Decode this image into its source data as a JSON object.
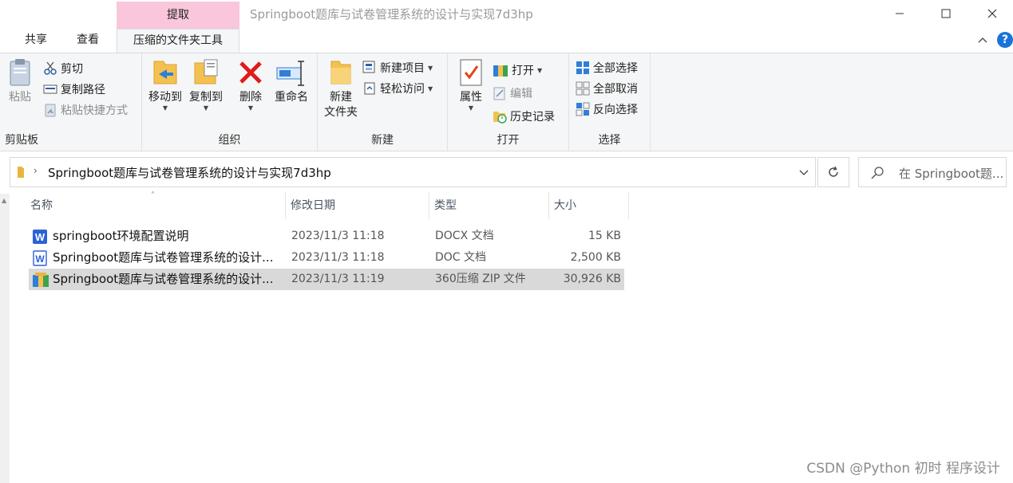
{
  "window": {
    "title": "Springboot题库与试卷管理系统的设计与实现7d3hp",
    "context_tab": "提取"
  },
  "tabs": {
    "share": "共享",
    "view": "查看",
    "tools": "压缩的文件夹工具"
  },
  "ribbon": {
    "clipboard": {
      "paste": "粘贴",
      "cut": "剪切",
      "copy_path": "复制路径",
      "paste_shortcut": "粘贴快捷方式",
      "label": "剪贴板"
    },
    "organize": {
      "move_to": "移动到",
      "copy_to": "复制到",
      "delete": "删除",
      "rename": "重命名",
      "label": "组织"
    },
    "new": {
      "new_folder_line1": "新建",
      "new_folder_line2": "文件夹",
      "new_item": "新建项目",
      "easy_access": "轻松访问",
      "label": "新建"
    },
    "open": {
      "properties": "属性",
      "open": "打开",
      "edit": "编辑",
      "history": "历史记录",
      "label": "打开"
    },
    "select": {
      "select_all": "全部选择",
      "select_none": "全部取消",
      "invert": "反向选择",
      "label": "选择"
    }
  },
  "address": {
    "path": "Springboot题库与试卷管理系统的设计与实现7d3hp",
    "search_placeholder": "在 Springboot题..."
  },
  "columns": {
    "name": "名称",
    "date": "修改日期",
    "type": "类型",
    "size": "大小"
  },
  "files": [
    {
      "name": "springboot环境配置说明",
      "date": "2023/11/3 11:18",
      "type": "DOCX 文档",
      "size": "15 KB",
      "icon": "wps-word-icon"
    },
    {
      "name": "Springboot题库与试卷管理系统的设计...",
      "date": "2023/11/3 11:18",
      "type": "DOC 文档",
      "size": "2,500 KB",
      "icon": "word-doc-icon"
    },
    {
      "name": "Springboot题库与试卷管理系统的设计...",
      "date": "2023/11/3 11:19",
      "type": "360压缩 ZIP 文件",
      "size": "30,926 KB",
      "icon": "zip-archive-icon",
      "selected": true
    }
  ],
  "watermark": "CSDN @Python 初时 程序设计",
  "colors": {
    "context_tab": "#f9c6db",
    "ribbon_bg": "#f5f6f7",
    "selection": "#d9d9d9",
    "help_blue": "#1a73d8"
  }
}
